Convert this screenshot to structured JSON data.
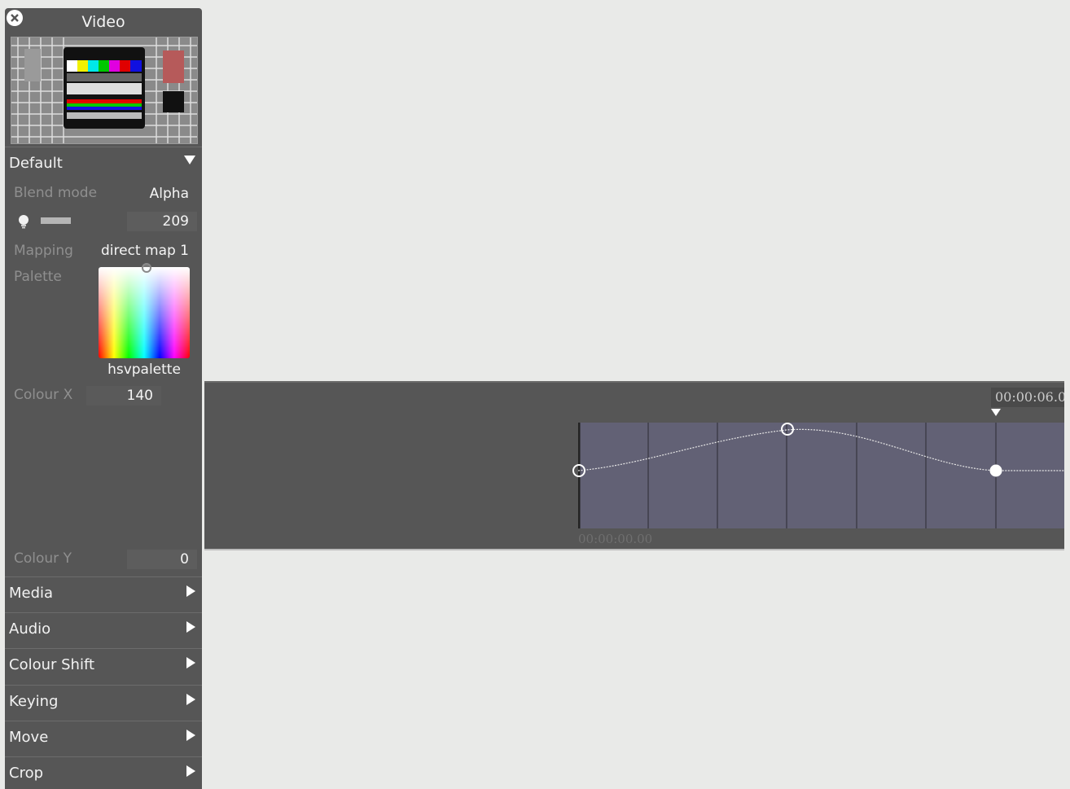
{
  "panel": {
    "title": "Video",
    "close_icon": "close-icon",
    "thumbnail_icon": "test-card-thumbnail"
  },
  "default_section": {
    "label": "Default",
    "expanded": true,
    "blend_mode_label": "Blend mode",
    "blend_mode_value": "Alpha",
    "brightness_icon": "lightbulb-icon",
    "brightness_value": "209",
    "mapping_label": "Mapping",
    "mapping_value": "direct map 1",
    "palette_label": "Palette",
    "palette_name": "hsvpalette",
    "colour_x_label": "Colour X",
    "colour_x_value": "140",
    "colour_y_label": "Colour Y",
    "colour_y_value": "0"
  },
  "sections": [
    {
      "label": "Media"
    },
    {
      "label": "Audio"
    },
    {
      "label": "Colour Shift"
    },
    {
      "label": "Keying"
    },
    {
      "label": "Move"
    },
    {
      "label": "Crop"
    }
  ],
  "timeline": {
    "start_time": "00:00:00.00",
    "end_time": "00:00:06.0"
  },
  "colors": {
    "panel_bg": "#565656",
    "page_bg": "#e9eae8",
    "curve_bg": "#626175"
  }
}
